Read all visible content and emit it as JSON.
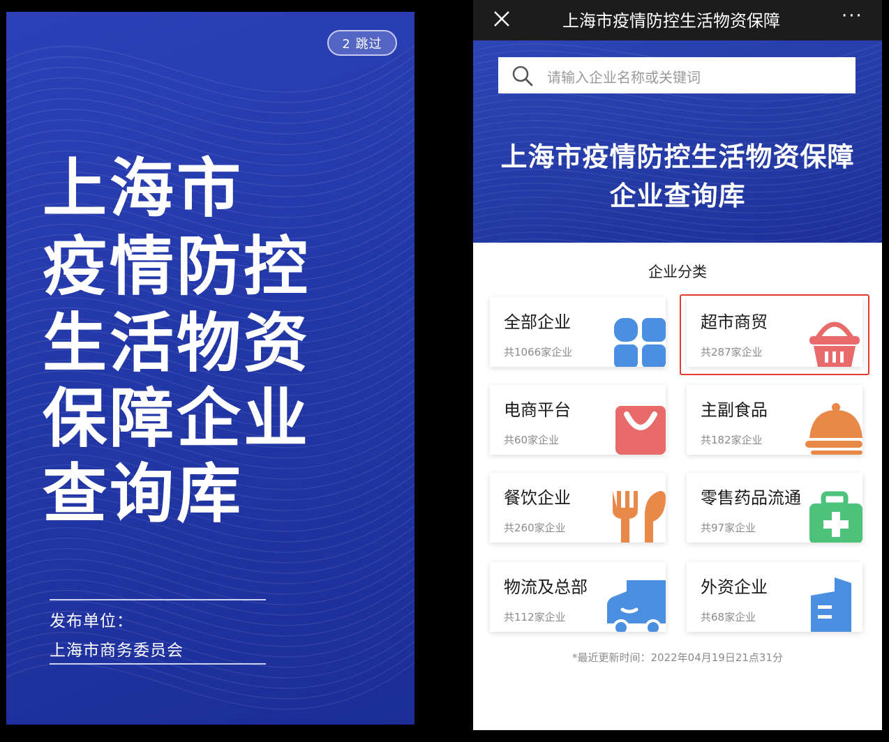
{
  "splash": {
    "skip_label": "2 跳过",
    "title_lines": [
      "上海市",
      "疫情防控",
      "生活物资",
      "保障企业",
      "查询库"
    ],
    "publisher_label": "发布单位：",
    "publisher_name": "上海市商务委员会",
    "bg_color": "#2338a8"
  },
  "app": {
    "window_title": "上海市疫情防控生活物资保障",
    "more_label": "···",
    "search": {
      "placeholder": "请输入企业名称或关键词"
    },
    "hero_title_lines": [
      "上海市疫情防控生活物资保障",
      "企业查询库"
    ],
    "category_title": "企业分类",
    "categories": [
      {
        "name": "全部企业",
        "count": "共1066家企业",
        "icon": "grid-icon",
        "color": "#4a8fe0"
      },
      {
        "name": "超市商贸",
        "count": "共287家企业",
        "icon": "basket-icon",
        "color": "#e86a6a",
        "highlighted": true
      },
      {
        "name": "电商平台",
        "count": "共60家企业",
        "icon": "shopping-bag-icon",
        "color": "#e86a6a"
      },
      {
        "name": "主副食品",
        "count": "共182家企业",
        "icon": "food-cloche-icon",
        "color": "#e8894a"
      },
      {
        "name": "餐饮企业",
        "count": "共260家企业",
        "icon": "fork-knife-icon",
        "color": "#e8894a"
      },
      {
        "name": "零售药品流通",
        "count": "共97家企业",
        "icon": "medical-kit-icon",
        "color": "#4cc27a"
      },
      {
        "name": "物流及总部",
        "count": "共112家企业",
        "icon": "truck-icon",
        "color": "#4a8fe0"
      },
      {
        "name": "外资企业",
        "count": "共68家企业",
        "icon": "building-icon",
        "color": "#4a8fe0"
      }
    ],
    "updated_text": "*最近更新时间：2022年04月19日21点31分",
    "highlight_color": "#e23a2e"
  }
}
